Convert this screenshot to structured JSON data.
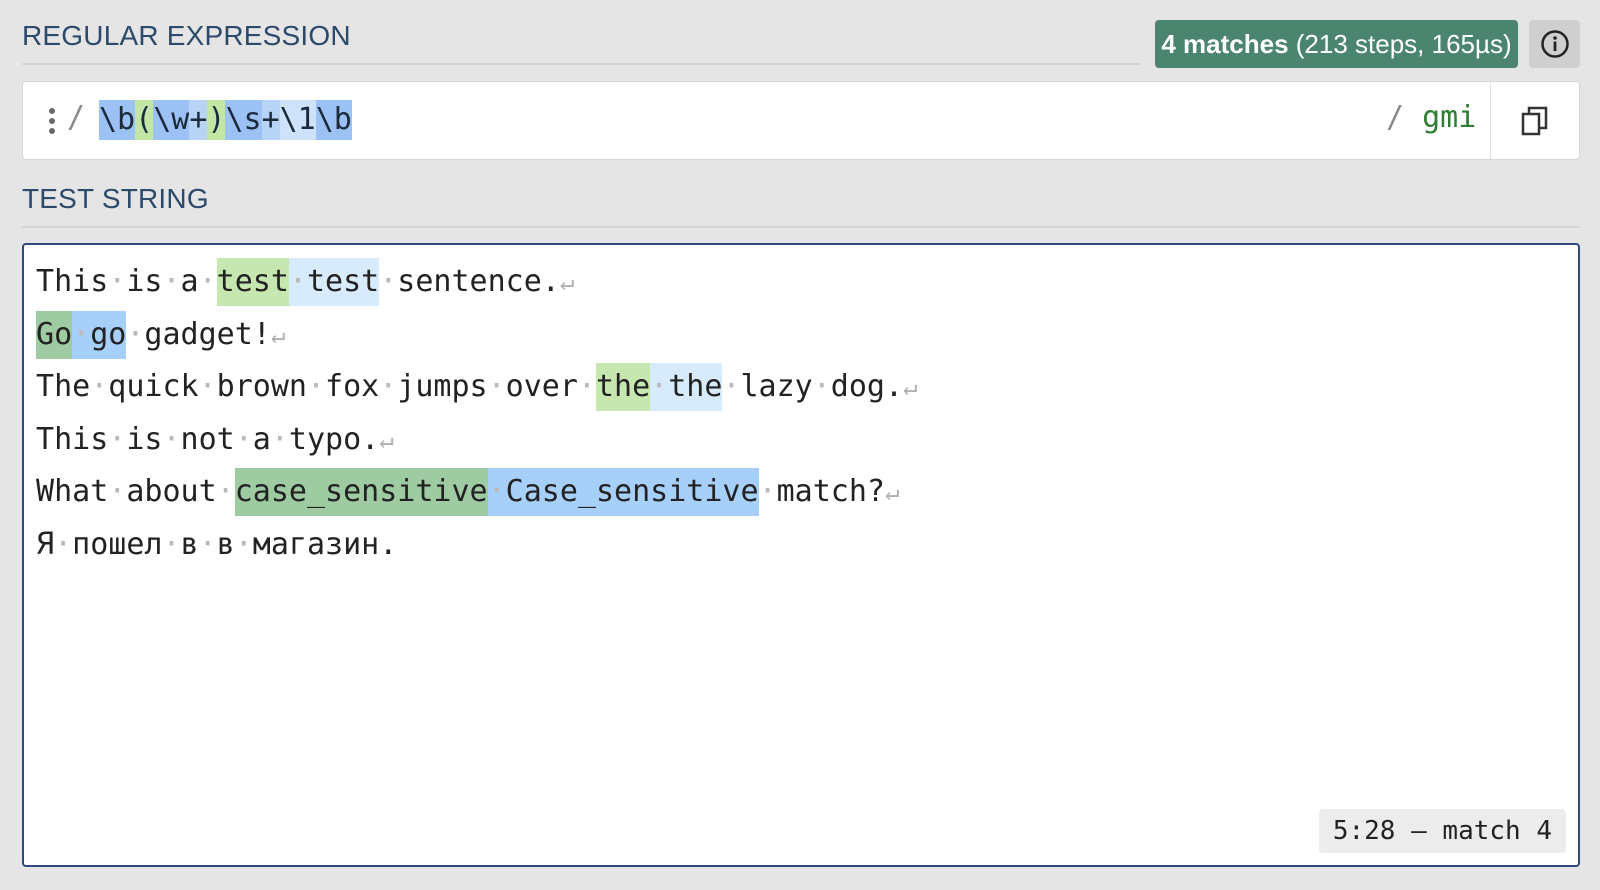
{
  "regex_section": {
    "title": "REGULAR EXPRESSION"
  },
  "badge": {
    "count": "4 matches",
    "detail": " (213 steps, 165µs)"
  },
  "info": {
    "icon": "info-icon"
  },
  "regex": {
    "open_delim": "/",
    "tokens": [
      {
        "t": "\\b",
        "k": "esc"
      },
      {
        "t": "(",
        "k": "grp"
      },
      {
        "t": "\\w",
        "k": "esc"
      },
      {
        "t": "+",
        "k": "q"
      },
      {
        "t": ")",
        "k": "grp"
      },
      {
        "t": "\\s",
        "k": "esc"
      },
      {
        "t": "+",
        "k": "q"
      },
      {
        "t": "\\1",
        "k": "back"
      },
      {
        "t": "\\b",
        "k": "esc"
      }
    ],
    "close_delim": "/",
    "flags": "gmi",
    "copy_icon": "copy-icon"
  },
  "test_section": {
    "title": "TEST STRING"
  },
  "test_lines": [
    [
      {
        "t": "This·is·a·"
      },
      {
        "t": "test",
        "m": "m1"
      },
      {
        "t": "·test",
        "m": "m2"
      },
      {
        "t": "·sentence."
      },
      {
        "t": "↵",
        "nl": true
      }
    ],
    [
      {
        "t": "Go",
        "m": "m3"
      },
      {
        "t": "·go",
        "m": "m4"
      },
      {
        "t": "·gadget!"
      },
      {
        "t": "↵",
        "nl": true
      }
    ],
    [
      {
        "t": "The·quick·brown·fox·jumps·over·"
      },
      {
        "t": "the",
        "m": "m1"
      },
      {
        "t": "·the",
        "m": "m2"
      },
      {
        "t": "·lazy·dog."
      },
      {
        "t": "↵",
        "nl": true
      }
    ],
    [
      {
        "t": "This·is·not·a·typo."
      },
      {
        "t": "↵",
        "nl": true
      }
    ],
    [
      {
        "t": "What·about·"
      },
      {
        "t": "case_sensitive",
        "m": "m3"
      },
      {
        "t": "·Case_sensitive",
        "m": "m4"
      },
      {
        "t": "·match?"
      },
      {
        "t": "↵",
        "nl": true
      }
    ],
    [
      {
        "t": "Я·пошел·в·в·магазин."
      }
    ]
  ],
  "status": {
    "text": "5:28 — match 4"
  }
}
